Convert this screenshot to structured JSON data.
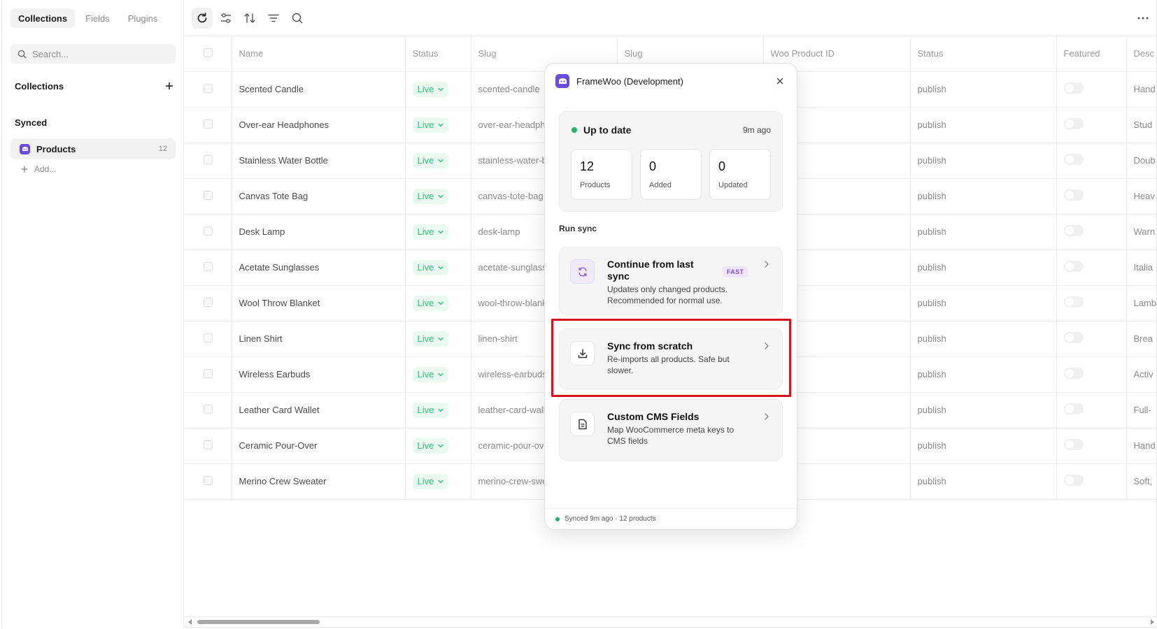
{
  "sidebar": {
    "tabs": [
      {
        "label": "Collections",
        "active": true
      },
      {
        "label": "Fields",
        "active": false
      },
      {
        "label": "Plugins",
        "active": false
      }
    ],
    "search_placeholder": "Search...",
    "collections_label": "Collections",
    "synced_label": "Synced",
    "products_item": {
      "label": "Products",
      "count": "12"
    },
    "add_label": "Add..."
  },
  "toolbar": {
    "icons": [
      "refresh-icon",
      "sliders-icon",
      "sort-icon",
      "filter-icon",
      "search-icon"
    ],
    "more_icon": "more-dots-icon"
  },
  "table": {
    "columns": [
      "Name",
      "Status",
      "Slug",
      "Slug",
      "Woo Product ID",
      "Status",
      "Featured",
      "Desc"
    ],
    "rows": [
      {
        "name": "Scented Candle",
        "status": "Live",
        "slug": "scented-candle",
        "wp_status": "publish",
        "desc": "Hand"
      },
      {
        "name": "Over-ear Headphones",
        "status": "Live",
        "slug": "over-ear-headphones",
        "wp_status": "publish",
        "desc": "Stud"
      },
      {
        "name": "Stainless Water Bottle",
        "status": "Live",
        "slug": "stainless-water-bottle",
        "wp_status": "publish",
        "desc": "Doub"
      },
      {
        "name": "Canvas Tote Bag",
        "status": "Live",
        "slug": "canvas-tote-bag",
        "wp_status": "publish",
        "desc": "Heav"
      },
      {
        "name": "Desk Lamp",
        "status": "Live",
        "slug": "desk-lamp",
        "wp_status": "publish",
        "desc": "Warn"
      },
      {
        "name": "Acetate Sunglasses",
        "status": "Live",
        "slug": "acetate-sunglasses",
        "wp_status": "publish",
        "desc": "Italia"
      },
      {
        "name": "Wool Throw Blanket",
        "status": "Live",
        "slug": "wool-throw-blanket",
        "wp_status": "publish",
        "desc": "Lamb"
      },
      {
        "name": "Linen Shirt",
        "status": "Live",
        "slug": "linen-shirt",
        "wp_status": "publish",
        "desc": "Brea"
      },
      {
        "name": "Wireless Earbuds",
        "status": "Live",
        "slug": "wireless-earbuds",
        "wp_status": "publish",
        "desc": "Activ"
      },
      {
        "name": "Leather Card Wallet",
        "status": "Live",
        "slug": "leather-card-wallet",
        "wp_status": "publish",
        "desc": "Full-"
      },
      {
        "name": "Ceramic Pour-Over",
        "status": "Live",
        "slug": "ceramic-pour-over",
        "wp_status": "publish",
        "desc": "Hand"
      },
      {
        "name": "Merino Crew Sweater",
        "status": "Live",
        "slug": "merino-crew-sweater",
        "wp_status": "publish",
        "desc": "Soft,"
      }
    ]
  },
  "panel": {
    "title": "FrameWoo (Development)",
    "status": {
      "label": "Up to date",
      "ago": "9m ago"
    },
    "stats": [
      {
        "value": "12",
        "label": "Products"
      },
      {
        "value": "0",
        "label": "Added"
      },
      {
        "value": "0",
        "label": "Updated"
      }
    ],
    "run_sync_label": "Run sync",
    "actions": [
      {
        "title": "Continue from last sync",
        "badge": "FAST",
        "desc": "Updates only changed products. Recommended for normal use.",
        "icon": "sync-icon"
      },
      {
        "title": "Sync from scratch",
        "desc": "Re-imports all products. Safe but slower.",
        "icon": "download-icon"
      },
      {
        "title": "Custom CMS Fields",
        "desc": "Map WooCommerce meta keys to CMS fields",
        "icon": "document-icon"
      }
    ],
    "footer": "Synced 9m ago · 12 products"
  },
  "colors": {
    "brand": "#6a4cdb",
    "live_bg": "#eafaf0",
    "live_text": "#33c07a",
    "status_green": "#22b26b",
    "highlight": "#d4141c"
  }
}
